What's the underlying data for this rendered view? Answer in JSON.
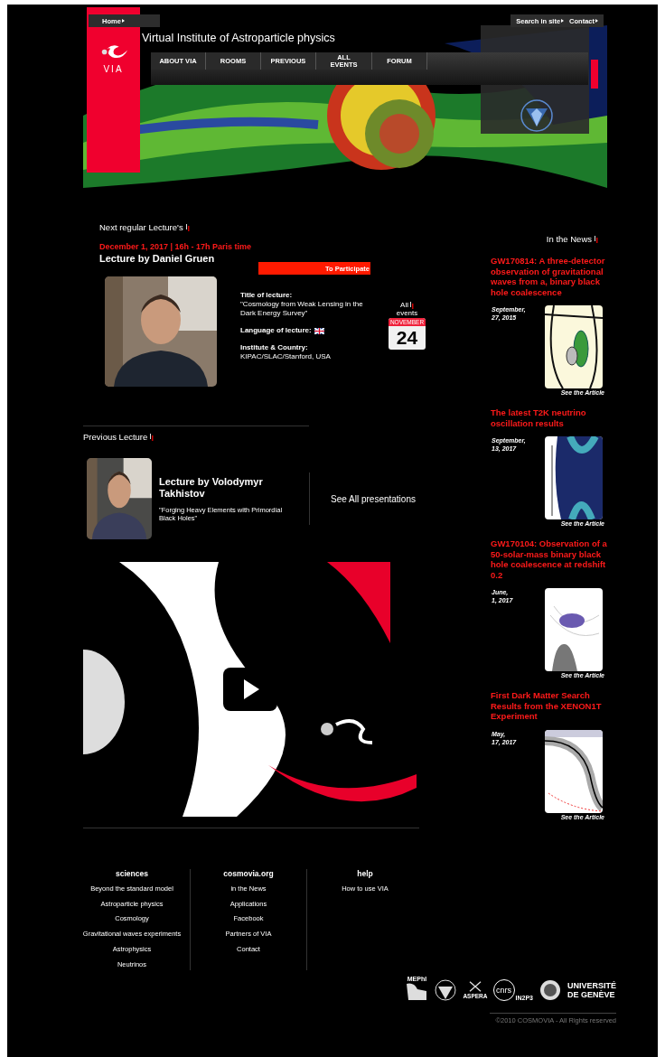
{
  "top_bar": {
    "left": [
      {
        "label": "Home"
      }
    ],
    "right": [
      {
        "label": "Search in site"
      },
      {
        "label": "Contact"
      }
    ]
  },
  "logo": {
    "label": "VIA"
  },
  "site_title": "Virtual Institute of Astroparticle physics",
  "nav": [
    {
      "label": "ABOUT VIA"
    },
    {
      "label": "ROOMS"
    },
    {
      "label": "PREVIOUS"
    },
    {
      "label": "ALL EVENTS"
    },
    {
      "label": "FORUM"
    }
  ],
  "next_lecture": {
    "heading": "Next regular Lecture's",
    "date": "December 1, 2017 | 16h - 17h Paris time",
    "title": "Lecture by Daniel Gruen",
    "button": "To Participate",
    "details": [
      {
        "kind": "text",
        "label": "Title of lecture:",
        "value": "\"Cosmology from Weak Lensing in the Dark Energy Survey\""
      },
      {
        "kind": "flag",
        "label": "Language of lecture:"
      },
      {
        "kind": "text",
        "label": "Institute & Country:",
        "value": "KIPAC/SLAC/Stanford, USA"
      }
    ]
  },
  "all_events": {
    "label": "All",
    "label_2": "events",
    "month": "NOVEMBER",
    "day": "24"
  },
  "previous_lecture": {
    "heading": "Previous Lecture",
    "title": "Lecture by Volodymyr Takhistov",
    "subtitle": "\"Forging Heavy Elements with Primordial Black Holes\"",
    "link": "See All presentations"
  },
  "news": {
    "heading": "In the News",
    "items": [
      {
        "title": "GW170814: A three-detector observation of gravitational waves from a, binary black hole coalescence",
        "date": [
          "September,",
          "27, 2015"
        ],
        "link": "See the Article"
      },
      {
        "title": "The latest T2K neutrino oscillation results",
        "date": [
          "September,",
          "13, 2017"
        ],
        "link": "See the Article"
      },
      {
        "title": "GW170104: Observation of a 50-solar-mass binary black hole coalescence at redshift 0.2",
        "date": [
          "June,",
          "1, 2017"
        ],
        "link": "See the Article"
      },
      {
        "title": "First Dark Matter Search Results from the XENON1T Experiment",
        "date": [
          "May,",
          "17, 2017"
        ],
        "link": "See the Article"
      }
    ]
  },
  "footer": [
    {
      "heading": "sciences",
      "links": [
        "Beyond the standard model",
        "Astroparticle physics",
        "Cosmology",
        "Gravitational waves experiments",
        "Astrophysics",
        "Neutrinos"
      ]
    },
    {
      "heading": "cosmovia.org",
      "links": [
        "in the News",
        "Applications",
        "Facebook",
        "Partners of VIA",
        "Contact"
      ]
    },
    {
      "heading": "help",
      "links": [
        "How to use VIA"
      ]
    }
  ],
  "partners": {
    "mephi": "MEPhI",
    "aspera": "ASPERA",
    "cnrs": "cnrs",
    "in2p3": "IN2P3",
    "unige": "UNIVERSITÉ",
    "unige_2": "DE GENÈVE"
  },
  "copyright": "©2010 COSMOVIA - All Rights reserved"
}
